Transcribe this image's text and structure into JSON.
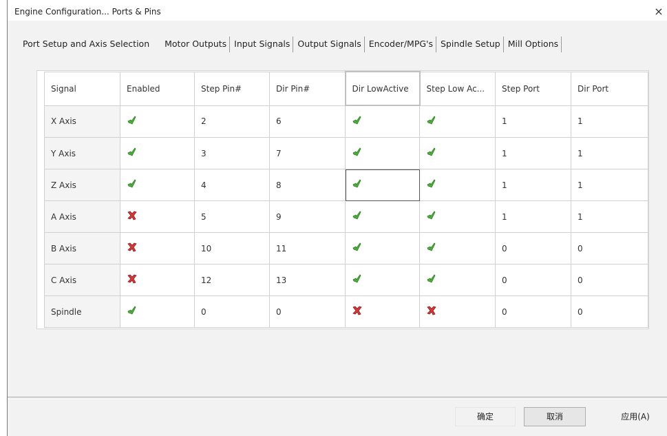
{
  "window": {
    "title": "Engine Configuration... Ports & Pins",
    "close_glyph": "×"
  },
  "tabs": [
    {
      "label": "Port Setup and Axis Selection",
      "active": false
    },
    {
      "label": "Motor Outputs",
      "active": true
    },
    {
      "label": "Input Signals",
      "active": false
    },
    {
      "label": "Output Signals",
      "active": false
    },
    {
      "label": "Encoder/MPG's",
      "active": false
    },
    {
      "label": "Spindle Setup",
      "active": false
    },
    {
      "label": "Mill Options",
      "active": false
    }
  ],
  "grid": {
    "columns": [
      "Signal",
      "Enabled",
      "Step Pin#",
      "Dir Pin#",
      "Dir LowActive",
      "Step Low Ac...",
      "Step Port",
      "Dir Port"
    ],
    "rows": [
      {
        "signal": "X Axis",
        "enabled": "check-icon",
        "step_pin": "2",
        "dir_pin": "6",
        "dir_low": "check-icon",
        "step_low": "check-icon",
        "step_port": "1",
        "dir_port": "1"
      },
      {
        "signal": "Y Axis",
        "enabled": "check-icon",
        "step_pin": "3",
        "dir_pin": "7",
        "dir_low": "check-icon",
        "step_low": "check-icon",
        "step_port": "1",
        "dir_port": "1"
      },
      {
        "signal": "Z Axis",
        "enabled": "check-icon",
        "step_pin": "4",
        "dir_pin": "8",
        "dir_low": "check-icon",
        "step_low": "check-icon",
        "step_port": "1",
        "dir_port": "1"
      },
      {
        "signal": "A Axis",
        "enabled": "x-icon",
        "step_pin": "5",
        "dir_pin": "9",
        "dir_low": "check-icon",
        "step_low": "check-icon",
        "step_port": "1",
        "dir_port": "1"
      },
      {
        "signal": "B Axis",
        "enabled": "x-icon",
        "step_pin": "10",
        "dir_pin": "11",
        "dir_low": "check-icon",
        "step_low": "check-icon",
        "step_port": "0",
        "dir_port": "0"
      },
      {
        "signal": "C Axis",
        "enabled": "x-icon",
        "step_pin": "12",
        "dir_pin": "13",
        "dir_low": "check-icon",
        "step_low": "check-icon",
        "step_port": "0",
        "dir_port": "0"
      },
      {
        "signal": "Spindle",
        "enabled": "check-icon",
        "step_pin": "0",
        "dir_pin": "0",
        "dir_low": "x-icon",
        "step_low": "x-icon",
        "step_port": "0",
        "dir_port": "0"
      }
    ]
  },
  "colors": {
    "check": "#4caf3c",
    "check_dark": "#2e7d22",
    "cross": "#d23a3a",
    "cross_dark": "#8c1e1e"
  },
  "buttons": {
    "ok": "确定",
    "cancel": "取消",
    "apply": "应用(A)"
  }
}
